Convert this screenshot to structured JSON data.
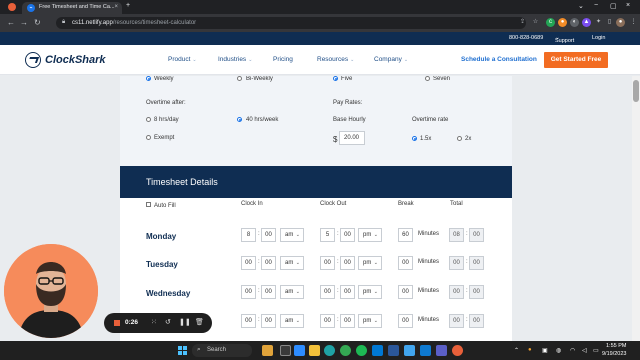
{
  "browser": {
    "tab_title": "Free Timesheet and Time Ca...",
    "url_domain": "cs11.netlify.app",
    "url_path": "/resources/timesheet-calculator"
  },
  "site_util": {
    "phone": "800-828-0689",
    "support": "Support",
    "login": "Login"
  },
  "site_nav": {
    "logo_text": "ClockShark",
    "items": [
      {
        "label": "Product",
        "dropdown": true
      },
      {
        "label": "Industries",
        "dropdown": true
      },
      {
        "label": "Pricing",
        "dropdown": false
      },
      {
        "label": "Resources",
        "dropdown": true
      },
      {
        "label": "Company",
        "dropdown": true
      }
    ],
    "schedule_label": "Schedule a Consultation",
    "cta_label": "Get Started Free"
  },
  "settings": {
    "pay_period_options": [
      {
        "label": "Weekly",
        "selected": true
      },
      {
        "label": "Bi-Weekly",
        "selected": false
      }
    ],
    "workdays_options": [
      {
        "label": "Five",
        "selected": true
      },
      {
        "label": "Seven",
        "selected": false
      }
    ],
    "overtime_after_title": "Overtime after:",
    "overtime_after_options": [
      {
        "label": "8 hrs/day",
        "selected": false
      },
      {
        "label": "40 hrs/week",
        "selected": true
      },
      {
        "label": "Exempt",
        "selected": false
      }
    ],
    "pay_rates_title": "Pay Rates:",
    "base_hourly_label": "Base Hourly",
    "currency_symbol": "$",
    "base_hourly_value": "20.00",
    "overtime_rate_label": "Overtime rate",
    "overtime_rate_options": [
      {
        "label": "1.5x",
        "selected": true
      },
      {
        "label": "2x",
        "selected": false
      }
    ]
  },
  "timesheet": {
    "title": "Timesheet Details",
    "auto_fill_label": "Auto Fill",
    "columns": {
      "clock_in": "Clock In",
      "clock_out": "Clock Out",
      "break": "Break",
      "total": "Total"
    },
    "minutes_label": "Minutes",
    "rows": [
      {
        "day": "Monday",
        "in_h": "8",
        "in_m": "00",
        "in_ampm": "am",
        "out_h": "5",
        "out_m": "00",
        "out_ampm": "pm",
        "break": "60",
        "total_h": "08",
        "total_m": "00"
      },
      {
        "day": "Tuesday",
        "in_h": "00",
        "in_m": "00",
        "in_ampm": "am",
        "out_h": "00",
        "out_m": "00",
        "out_ampm": "pm",
        "break": "00",
        "total_h": "00",
        "total_m": "00"
      },
      {
        "day": "Wednesday",
        "in_h": "00",
        "in_m": "00",
        "in_ampm": "am",
        "out_h": "00",
        "out_m": "00",
        "out_ampm": "pm",
        "break": "00",
        "total_h": "00",
        "total_m": "00"
      },
      {
        "day": "",
        "in_h": "00",
        "in_m": "00",
        "in_ampm": "am",
        "out_h": "00",
        "out_m": "00",
        "out_ampm": "pm",
        "break": "00",
        "total_h": "00",
        "total_m": "00"
      }
    ]
  },
  "recorder": {
    "elapsed": "0:26"
  },
  "taskbar": {
    "search_label": "Search",
    "time": "1:55 PM",
    "date": "9/19/2023"
  },
  "colors": {
    "navy": "#0f2d52",
    "orange": "#f26c22",
    "link_blue": "#1f6fd0",
    "radio_blue": "#1a73e8"
  }
}
